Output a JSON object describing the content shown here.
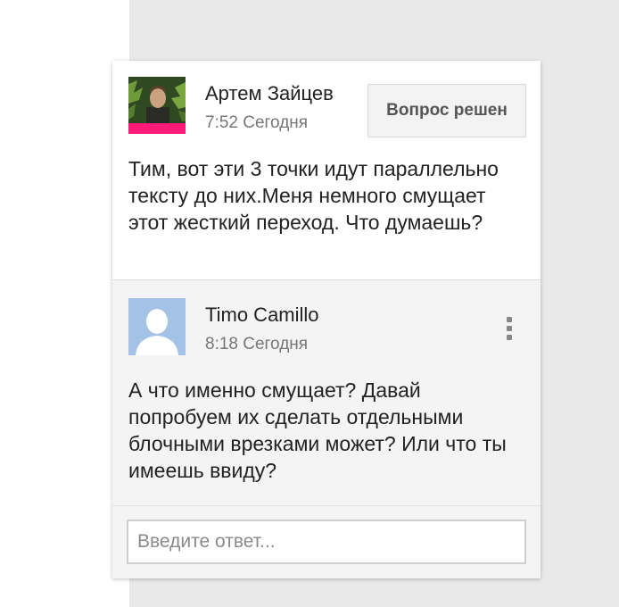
{
  "comment": {
    "author": "Артем Зайцев",
    "time": "7:52 Сегодня",
    "resolve_label": "Вопрос решен",
    "text": "Тим, вот эти 3 точки идут параллельно тексту до них.Меня немного смущает этот жесткий переход. Что думаешь?"
  },
  "reply": {
    "author": "Timo Camillo",
    "time": "8:18 Сегодня",
    "text": "А что именно смущает? Давай попробуем их сделать отдельными блочными врезками может? Или что ты имеешь ввиду?",
    "more_icon": "more-vertical-icon"
  },
  "reply_box": {
    "placeholder": "Введите ответ...",
    "value": ""
  },
  "colors": {
    "avatar_accent": "#ff1a7a",
    "default_avatar_bg": "#a4c1e6",
    "panel_bg": "#e9e9e9"
  }
}
